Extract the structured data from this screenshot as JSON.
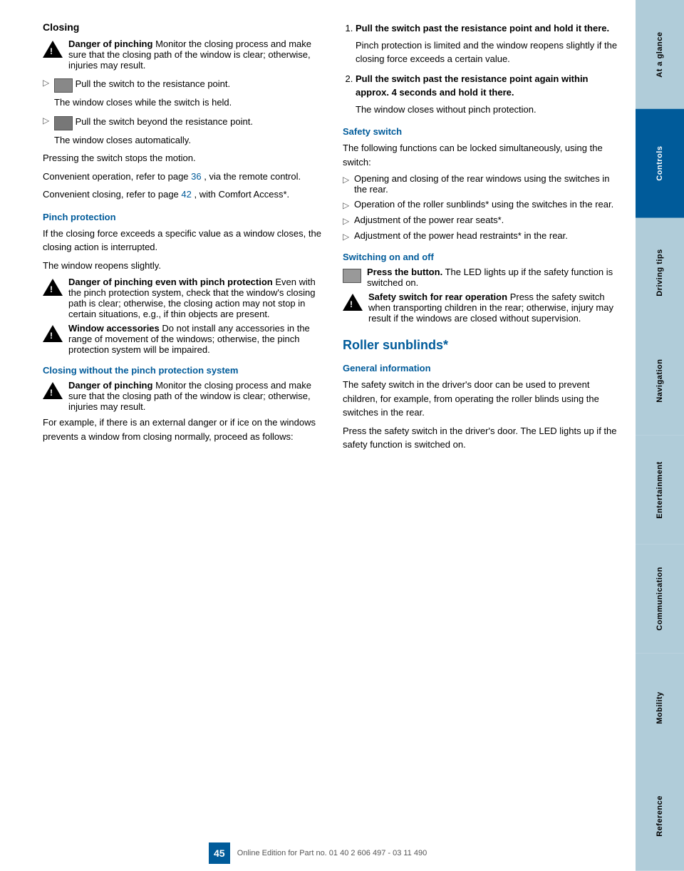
{
  "sidebar": {
    "tabs": [
      {
        "label": "At a glance",
        "active": false
      },
      {
        "label": "Controls",
        "active": true
      },
      {
        "label": "Driving tips",
        "active": false
      },
      {
        "label": "Navigation",
        "active": false
      },
      {
        "label": "Entertainment",
        "active": false
      },
      {
        "label": "Communication",
        "active": false
      },
      {
        "label": "Mobility",
        "active": false
      },
      {
        "label": "Reference",
        "active": false
      }
    ]
  },
  "left": {
    "closing_title": "Closing",
    "warning1_title": "Danger of pinching",
    "warning1_text": "Monitor the closing process and make sure that the closing path of the window is clear; otherwise, injuries may result.",
    "bullet1_icon": "switch",
    "bullet1_text": "Pull the switch to the resistance point.",
    "bullet1_sub": "The window closes while the switch is held.",
    "bullet2_icon": "switch2",
    "bullet2_text": "Pull the switch beyond the resistance point.",
    "bullet2_sub": "The window closes automatically.",
    "press_stop": "Pressing the switch stops the motion.",
    "convenient1": "Convenient operation, refer to page",
    "convenient1_page": "36",
    "convenient1_suffix": ", via the remote control.",
    "convenient2": "Convenient closing, refer to page",
    "convenient2_page": "42",
    "convenient2_suffix": ", with Comfort Access*.",
    "pinch_title": "Pinch protection",
    "pinch_p1": "If the closing force exceeds a specific value as a window closes, the closing action is interrupted.",
    "pinch_p2": "The window reopens slightly.",
    "warn2_title": "Danger of pinching even with pinch protection",
    "warn2_text": "Even with the pinch protection system, check that the window's closing path is clear; otherwise, the closing action may not stop in certain situations, e.g., if thin objects are present.",
    "warn3_title": "Window accessories",
    "warn3_text": "Do not install any accessories in the range of movement of the windows; otherwise, the pinch protection system will be impaired.",
    "closing_pinch_title": "Closing without the pinch protection system",
    "warn4_title": "Danger of pinching",
    "warn4_text": "Monitor the closing process and make sure that the closing path of the window is clear; otherwise, injuries may result.",
    "for_example": "For example, if there is an external danger or if ice on the windows prevents a window from closing normally, proceed as follows:"
  },
  "right": {
    "step1_num": "1.",
    "step1_text": "Pull the switch past the resistance point and hold it there.",
    "step1_detail": "Pinch protection is limited and the window reopens slightly if the closing force exceeds a certain value.",
    "step2_num": "2.",
    "step2_text": "Pull the switch past the resistance point again within approx. 4 seconds and hold it there.",
    "step2_detail": "The window closes without pinch protection.",
    "safety_title": "Safety switch",
    "safety_p1": "The following functions can be locked simultaneously, using the switch:",
    "safety_b1": "Opening and closing of the rear windows using the switches in the rear.",
    "safety_b2": "Operation of the roller sunblinds* using the switches in the rear.",
    "safety_b3": "Adjustment of the power rear seats*.",
    "safety_b4": "Adjustment of the power head restraints* in the rear.",
    "switching_title": "Switching on and off",
    "switch_step": "Press the button.",
    "switch_step_detail": "The LED lights up if the safety function is switched on.",
    "warn5_title": "Safety switch for rear operation",
    "warn5_text": "Press the safety switch when transporting children in the rear; otherwise, injury may result if the windows are closed without supervision.",
    "roller_title": "Roller sunblinds*",
    "general_title": "General information",
    "general_p1": "The safety switch in the driver's door can be used to prevent children, for example, from operating the roller blinds using the switches in the rear.",
    "general_p2": "Press the safety switch in the driver's door. The LED lights up if the safety function is switched on."
  },
  "footer": {
    "page_num": "45",
    "copyright": "Online Edition for Part no. 01 40 2 606 497 - 03 11 490"
  }
}
